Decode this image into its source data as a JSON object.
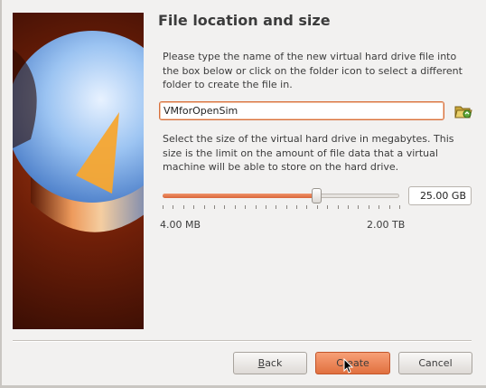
{
  "dialog": {
    "title": "File location and size"
  },
  "location": {
    "description": "Please type the name of the new virtual hard drive file into the box below or click on the folder icon to select a different folder to create the file in.",
    "file_name": "VMforOpenSim",
    "folder_button_icon": "folder-open-icon"
  },
  "size": {
    "description": "Select the size of the virtual hard drive in megabytes. This size is the limit on the amount of file data that a virtual machine will be able to store on the hard drive.",
    "value": "25.00 GB",
    "min_label": "4.00 MB",
    "max_label": "2.00 TB",
    "slider_fraction": 0.65
  },
  "buttons": {
    "back": "Back",
    "back_mnemonic": "B",
    "create": "Create",
    "cancel": "Cancel"
  },
  "colors": {
    "accent": "#e1703f",
    "banner": "#6f1f08"
  }
}
